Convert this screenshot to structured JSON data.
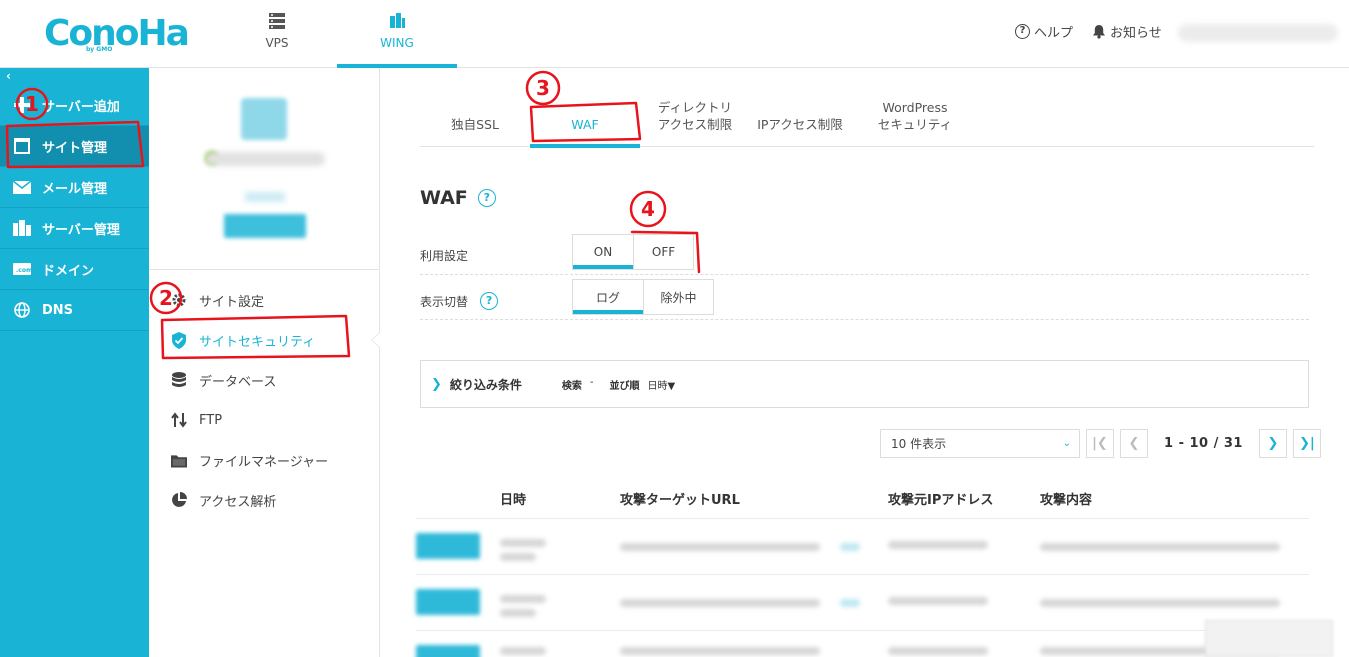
{
  "header": {
    "logo_text": "ConoHa",
    "logo_sub": "by GMO",
    "nav": [
      {
        "label": "VPS",
        "icon": "server-icon"
      },
      {
        "label": "WING",
        "icon": "wing-icon"
      }
    ],
    "help_label": "ヘルプ",
    "notice_label": "お知らせ"
  },
  "sidebar": {
    "collapse": "‹",
    "items": [
      {
        "label": "サーバー追加",
        "icon": "plus-icon"
      },
      {
        "label": "サイト管理",
        "icon": "window-icon"
      },
      {
        "label": "メール管理",
        "icon": "mail-icon"
      },
      {
        "label": "サーバー管理",
        "icon": "server-icon"
      },
      {
        "label": "ドメイン",
        "icon": "domain-icon"
      },
      {
        "label": "DNS",
        "icon": "globe-icon"
      }
    ]
  },
  "subnav": {
    "items": [
      {
        "label": "サイト設定",
        "icon": "gear-icon"
      },
      {
        "label": "サイトセキュリティ",
        "icon": "shield-icon"
      },
      {
        "label": "データベース",
        "icon": "database-icon"
      },
      {
        "label": "FTP",
        "icon": "transfer-icon"
      },
      {
        "label": "ファイルマネージャー",
        "icon": "folder-icon"
      },
      {
        "label": "アクセス解析",
        "icon": "pie-chart-icon"
      }
    ]
  },
  "tabs": [
    {
      "line1": "独自SSL",
      "line2": ""
    },
    {
      "line1": "WAF",
      "line2": ""
    },
    {
      "line1": "ディレクトリ",
      "line2": "アクセス制限"
    },
    {
      "line1": "IPアクセス制限",
      "line2": ""
    },
    {
      "line1": "WordPress",
      "line2": "セキュリティ"
    }
  ],
  "waf": {
    "title": "WAF",
    "usage_label": "利用設定",
    "usage_on": "ON",
    "usage_off": "OFF",
    "view_label": "表示切替",
    "view_log": "ログ",
    "view_excluded": "除外中"
  },
  "filter": {
    "title": "絞り込み条件",
    "search_key": "検索",
    "search_val": "-",
    "sort_key": "並び順",
    "sort_val": "日時▼"
  },
  "pager": {
    "per_page": "10 件表示",
    "range": "1 - 10 / 31"
  },
  "table": {
    "headers": [
      "日時",
      "攻撃ターゲットURL",
      "攻撃元IPアドレス",
      "攻撃内容"
    ]
  },
  "annotations": [
    "1",
    "2",
    "3",
    "4"
  ],
  "colors": {
    "accent": "#19b4d5",
    "sidebar_active": "#128fae",
    "annotation": "#e8141c"
  }
}
